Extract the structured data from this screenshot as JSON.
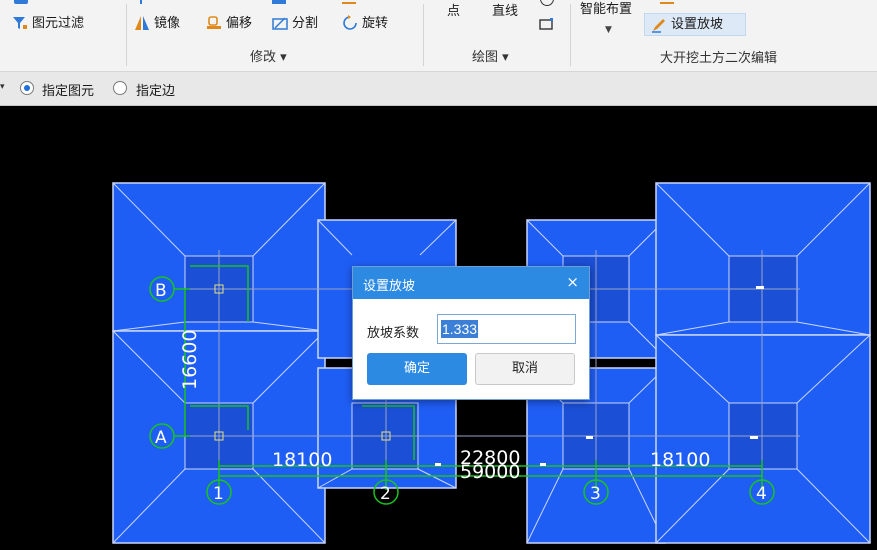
{
  "ribbon": {
    "filter_label": "图元过滤",
    "mirror_label": "镜像",
    "offset_label": "偏移",
    "split_label": "分割",
    "rotate_label": "旋转",
    "modify_group": "修改 ▾",
    "point_label": "点",
    "line_label": "直线",
    "draw_group": "绘图 ▾",
    "smart_layout_label": "智能布置",
    "set_slope_label": "设置放坡",
    "excavation_group": "大开挖土方二次编辑"
  },
  "options": {
    "specify_element": "指定图元",
    "specify_edge": "指定边"
  },
  "canvas": {
    "dims": {
      "d1": "18100",
      "d2": "22800",
      "d3": "59000",
      "d4": "18100",
      "vert": "16600"
    },
    "axes_x": [
      "1",
      "2",
      "3",
      "4"
    ],
    "axes_y": [
      "B",
      "A"
    ]
  },
  "dialog": {
    "title": "设置放坡",
    "close": "×",
    "field_label": "放坡系数",
    "field_value": "1.333",
    "ok": "确定",
    "cancel": "取消"
  },
  "colors": {
    "slab": "#1f5ef5",
    "slab_dark": "#1b4fd6",
    "outline": "#c9d6ff",
    "dim_line": "#19c41c",
    "accent": "#2d8ae3"
  }
}
